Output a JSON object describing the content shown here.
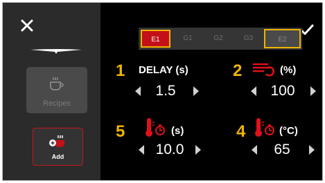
{
  "sidebar": {
    "recipes_label": "Recipes",
    "add_label": "Add"
  },
  "groups": [
    "E1",
    "G1",
    "G2",
    "G3",
    "E2"
  ],
  "params": {
    "delay": {
      "badge": "1",
      "label": "DELAY (s)",
      "value": "1.5"
    },
    "flow": {
      "badge": "2",
      "label": "(%)",
      "value": "100"
    },
    "temp_time": {
      "badge": "5",
      "label": "(s)",
      "value": "10.0"
    },
    "temp": {
      "badge": "4",
      "label": "(°C)",
      "value": "65"
    }
  },
  "colors": {
    "accent_red": "#c41018",
    "highlight_yellow": "#f0b400"
  },
  "icons": [
    "close-icon",
    "check-icon",
    "cup-icon",
    "add-cup-icon",
    "steam-icon",
    "thermometer-timer-icon"
  ]
}
